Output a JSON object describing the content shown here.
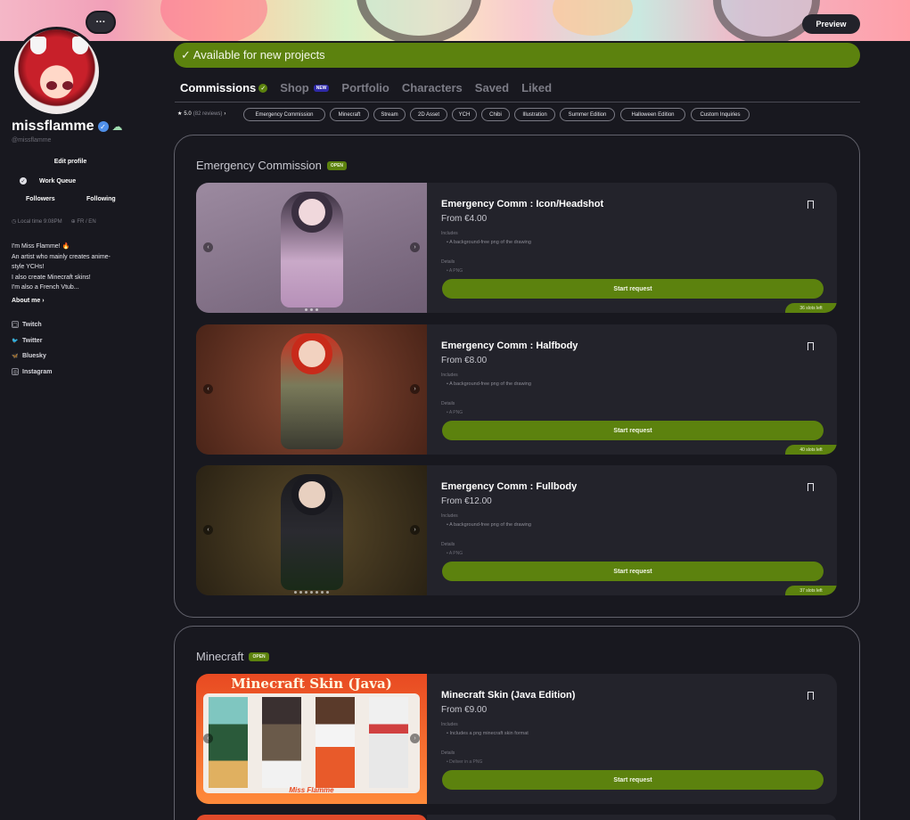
{
  "header": {
    "preview_label": "Preview"
  },
  "profile": {
    "more_label": "···",
    "username": "missflamme",
    "handle": "@missflamme",
    "edit_profile": "Edit profile",
    "work_queue": "Work Queue",
    "followers": "Followers",
    "following": "Following",
    "local_time": "Local time 9:08PM",
    "languages": "FR / EN",
    "bio": [
      "I'm Miss Flamme! 🔥",
      "An artist who mainly creates anime-",
      "style YCHs!",
      "I also create Minecraft skins!",
      "I'm also a French Vtub..."
    ],
    "about": "About me ›",
    "socials": [
      {
        "label": "Twitch",
        "icon": "twitch-icon"
      },
      {
        "label": "Twitter",
        "icon": "twitter-icon"
      },
      {
        "label": "Bluesky",
        "icon": "bluesky-icon"
      },
      {
        "label": "Instagram",
        "icon": "instagram-icon"
      }
    ]
  },
  "availability": "✓ Available for new projects",
  "tabs": [
    {
      "label": "Commissions",
      "active": true
    },
    {
      "label": "Shop",
      "badge": "NEW"
    },
    {
      "label": "Portfolio"
    },
    {
      "label": "Characters"
    },
    {
      "label": "Saved"
    },
    {
      "label": "Liked"
    }
  ],
  "rating": {
    "score": "5.0",
    "reviews": "(82 reviews)"
  },
  "chips": [
    "Emergency Commission",
    "Minecraft",
    "Stream",
    "2D Asset",
    "YCH",
    "Chibi",
    "Illustration",
    "Summer Edition",
    "Halloween Edition",
    "Custom Inquiries"
  ],
  "sections": [
    {
      "title": "Emergency Commission",
      "badge": "OPEN",
      "cards": [
        {
          "title": "Emergency Comm : Icon/Headshot",
          "price": "From €4.00",
          "includes_label": "Includes",
          "includes": "•    A background-free png of the drawing",
          "details_label": "Details",
          "details": "•    A PNG",
          "button": "Start request",
          "slots": "36 slots left"
        },
        {
          "title": "Emergency Comm : Halfbody",
          "price": "From €8.00",
          "includes_label": "Includes",
          "includes": "•    A background-free png of the drawing",
          "details_label": "Details",
          "details": "•    A PNG",
          "button": "Start request",
          "slots": "40 slots left"
        },
        {
          "title": "Emergency Comm : Fullbody",
          "price": "From €12.00",
          "includes_label": "Includes",
          "includes": "•    A background-free png of the drawing",
          "details_label": "Details",
          "details": "•    A PNG",
          "button": "Start request",
          "slots": "37 slots left"
        }
      ]
    },
    {
      "title": "Minecraft",
      "badge": "OPEN",
      "cards": [
        {
          "title": "Minecraft Skin (Java Edition)",
          "price": "From €9.00",
          "includes_label": "Includes",
          "includes": "•    Includes a png minecraft skin format",
          "details_label": "Details",
          "details": "•    Deliver in a PNG",
          "button": "Start request",
          "image_text": "Minecraft Skin (Java)",
          "image_logo": "Miss Flamme"
        }
      ]
    }
  ]
}
